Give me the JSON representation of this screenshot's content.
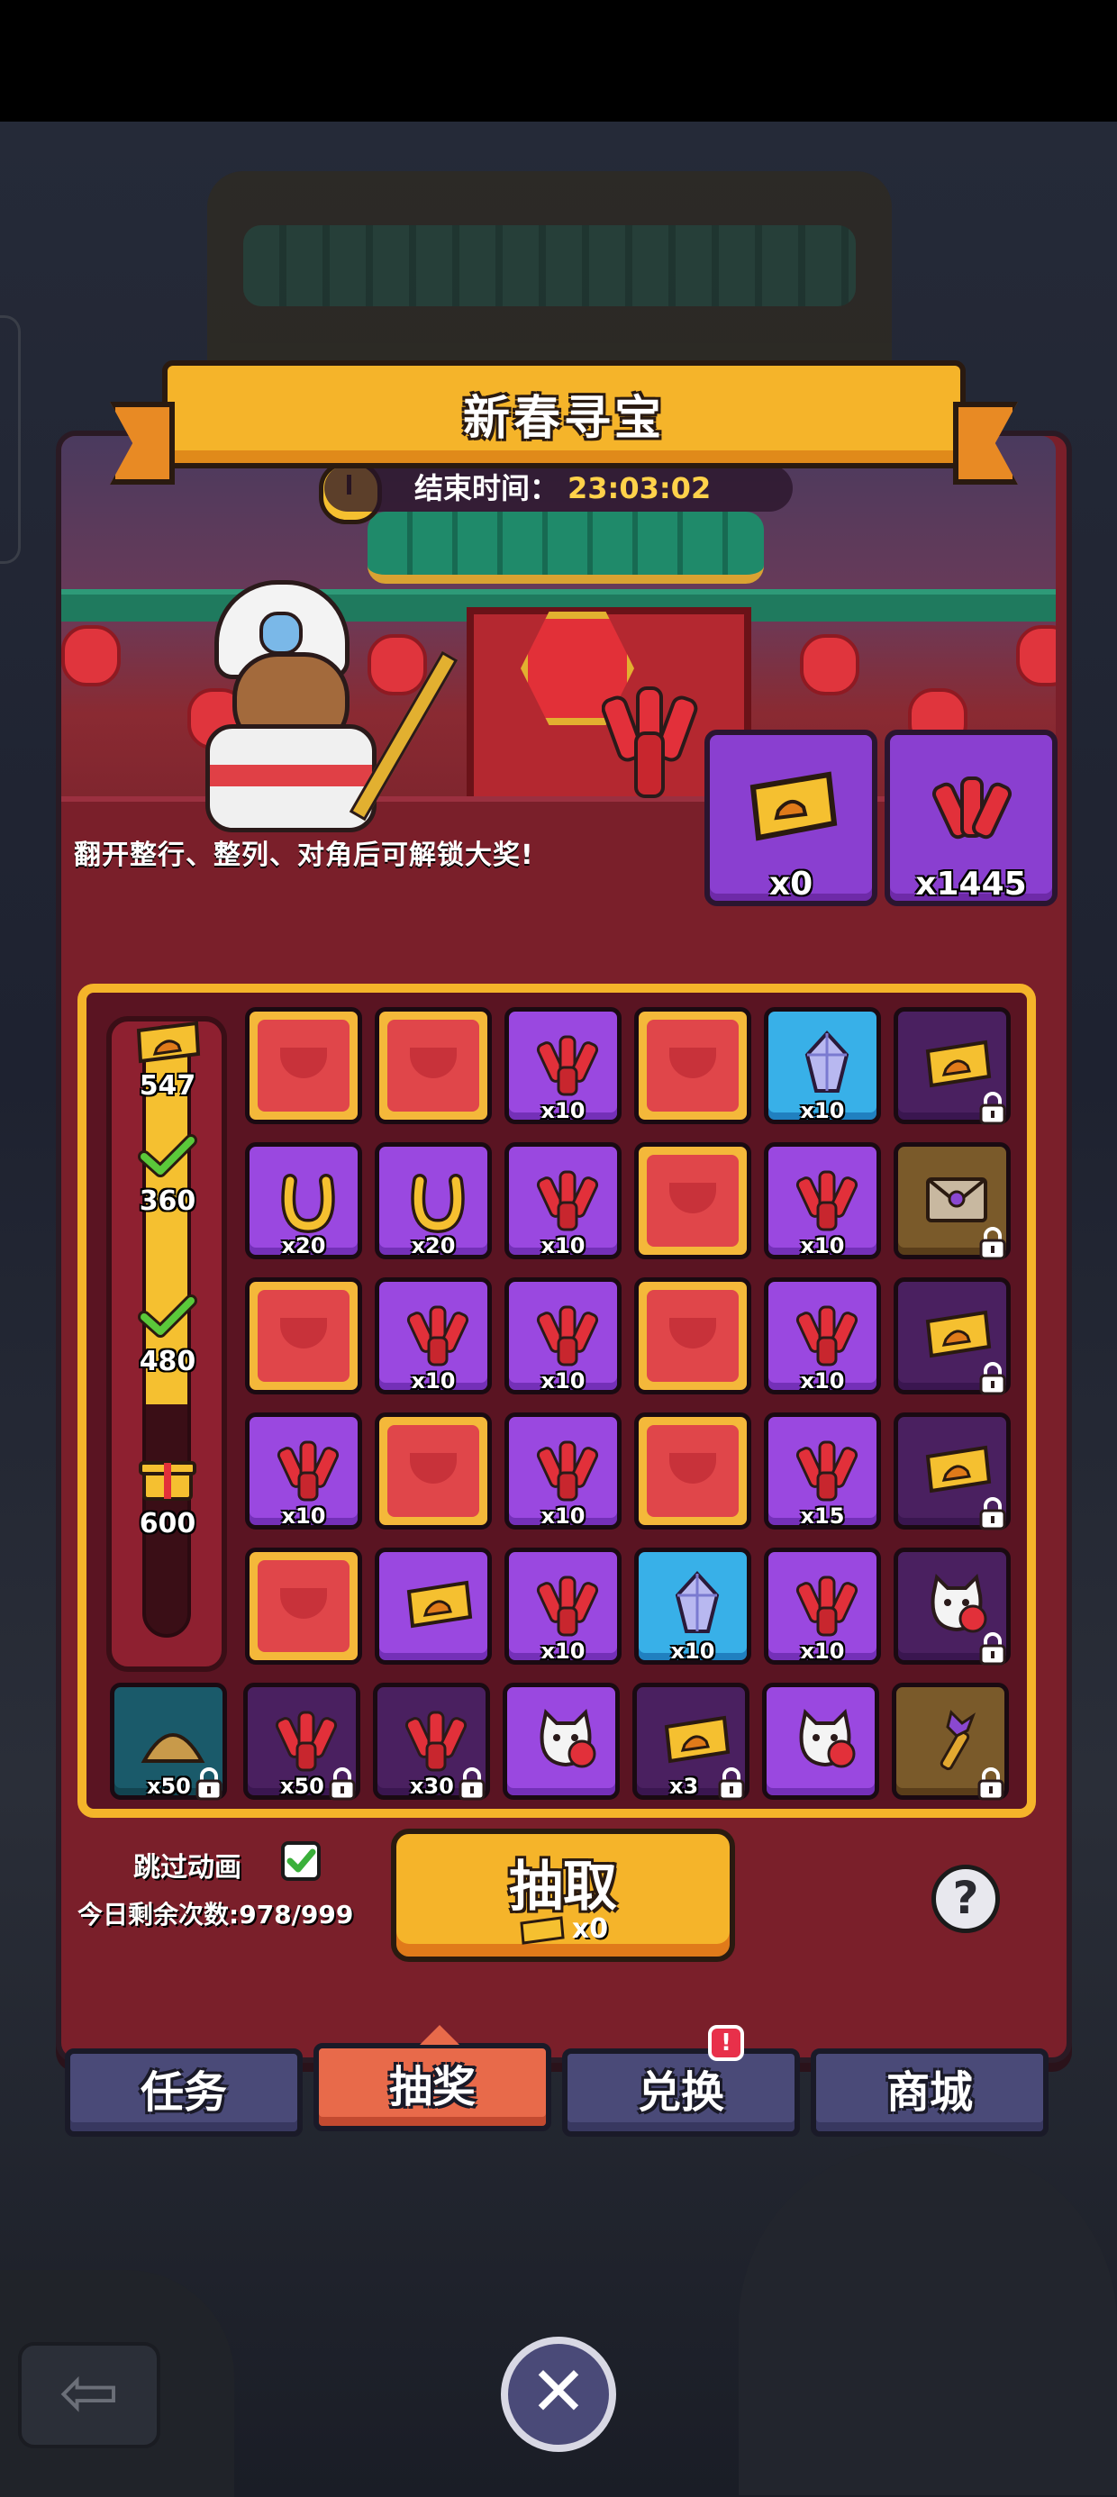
{
  "event": {
    "title": "新春寻宝",
    "end_time_label": "结束时间：",
    "end_time_value": "23:03:02",
    "hint": "翻开整行、整列、对角后可解锁大奖!"
  },
  "currencies": [
    {
      "icon": "gold-ticket-icon",
      "count": "x0"
    },
    {
      "icon": "firecracker-icon",
      "count": "x1445"
    }
  ],
  "progress": {
    "fill_fraction": 0.62,
    "milestones": [
      {
        "icon": "gold-ticket-icon",
        "value": "547",
        "claimed": false
      },
      {
        "icon": "check-icon",
        "value": "360",
        "claimed": true
      },
      {
        "icon": "check-icon",
        "value": "480",
        "claimed": true
      },
      {
        "icon": "gift-box-icon",
        "value": "600",
        "claimed": false
      }
    ]
  },
  "grid": {
    "rows": [
      [
        {
          "type": "hidden"
        },
        {
          "type": "hidden"
        },
        {
          "type": "purple",
          "icon": "firecracker-icon",
          "qty": "x10"
        },
        {
          "type": "hidden"
        },
        {
          "type": "blue",
          "icon": "crystal-icon",
          "qty": "x10"
        },
        {
          "type": "dark",
          "icon": "gold-ticket-icon",
          "locked": true
        }
      ],
      [
        {
          "type": "purple",
          "icon": "horseshoe-icon",
          "qty": "x20"
        },
        {
          "type": "purple",
          "icon": "horseshoe-icon",
          "qty": "x20"
        },
        {
          "type": "purple",
          "icon": "firecracker-icon",
          "qty": "x10"
        },
        {
          "type": "hidden"
        },
        {
          "type": "purple",
          "icon": "firecracker-icon",
          "qty": "x10"
        },
        {
          "type": "brown",
          "icon": "envelope-icon",
          "locked": true
        }
      ],
      [
        {
          "type": "hidden"
        },
        {
          "type": "purple",
          "icon": "firecracker-icon",
          "qty": "x10"
        },
        {
          "type": "purple",
          "icon": "firecracker-icon",
          "qty": "x10"
        },
        {
          "type": "hidden"
        },
        {
          "type": "purple",
          "icon": "firecracker-icon",
          "qty": "x10"
        },
        {
          "type": "dark",
          "icon": "gold-ticket-icon",
          "locked": true
        }
      ],
      [
        {
          "type": "purple",
          "icon": "firecracker-icon",
          "qty": "x10"
        },
        {
          "type": "hidden"
        },
        {
          "type": "purple",
          "icon": "firecracker-icon",
          "qty": "x10"
        },
        {
          "type": "hidden"
        },
        {
          "type": "purple",
          "icon": "firecracker-icon",
          "qty": "x15"
        },
        {
          "type": "dark",
          "icon": "gold-ticket-icon",
          "locked": true
        }
      ],
      [
        {
          "type": "hidden"
        },
        {
          "type": "purple",
          "icon": "gold-ticket-icon",
          "qty": ""
        },
        {
          "type": "purple",
          "icon": "firecracker-icon",
          "qty": "x10"
        },
        {
          "type": "blue",
          "icon": "crystal-icon",
          "qty": "x10"
        },
        {
          "type": "purple",
          "icon": "firecracker-icon",
          "qty": "x10"
        },
        {
          "type": "dark",
          "icon": "cat-pet-icon",
          "locked": true
        }
      ]
    ],
    "bottom_row": [
      {
        "type": "teal",
        "icon": "gold-dust-icon",
        "qty": "x50",
        "locked": true
      },
      {
        "type": "dark",
        "icon": "firecracker-icon",
        "qty": "x50",
        "locked": true
      },
      {
        "type": "dark",
        "icon": "firecracker-icon",
        "qty": "x30",
        "locked": true
      },
      {
        "type": "purple",
        "icon": "cat-pet-icon",
        "qty": "",
        "locked": false
      },
      {
        "type": "dark",
        "icon": "gold-ticket-icon",
        "qty": "x3",
        "locked": true
      },
      {
        "type": "purple",
        "icon": "cat-pet-icon",
        "qty": "",
        "locked": false
      },
      {
        "type": "brown",
        "icon": "magic-wand-icon",
        "qty": "",
        "locked": true
      }
    ]
  },
  "controls": {
    "skip_animation_label": "跳过动画",
    "skip_animation_checked": true,
    "remaining_label": "今日剩余次数:978/999",
    "draw_label": "抽取",
    "draw_cost": "x0"
  },
  "tabs": [
    {
      "label": "任务",
      "active": false
    },
    {
      "label": "抽奖",
      "active": true
    },
    {
      "label": "兑换",
      "active": false,
      "badge": "!"
    },
    {
      "label": "商城",
      "active": false
    }
  ],
  "colors": {
    "banner": "#f5b42a",
    "panel": "#7a1f2a",
    "tab_active": "#e86a4a",
    "tab_inactive": "#4a4a78"
  }
}
